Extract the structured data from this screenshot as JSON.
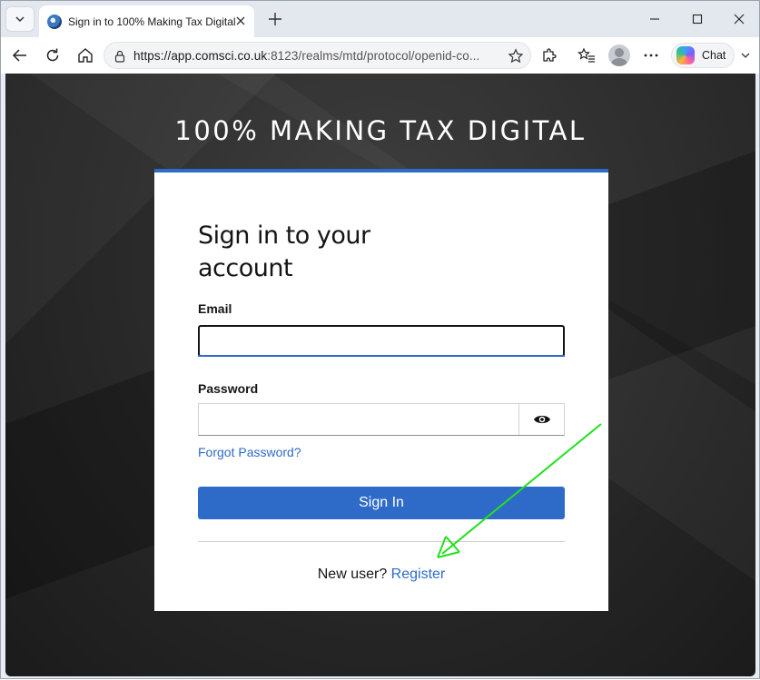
{
  "browser": {
    "tab": {
      "title": "Sign in to 100% Making Tax Digital"
    },
    "address": {
      "url_host": "https://app.comsci.co.uk",
      "url_rest": ":8123/realms/mtd/protocol/openid-co..."
    },
    "chat_label": "Chat",
    "icons": [
      "tab-list-icon",
      "favicon-icon",
      "close-icon",
      "plus-icon",
      "minimize-icon",
      "maximize-icon",
      "close-window-icon",
      "back-icon",
      "refresh-icon",
      "home-icon",
      "lock-icon",
      "star-icon",
      "extensions-icon",
      "favorites-icon",
      "avatar",
      "more-icon",
      "copilot-icon",
      "chevron-down-icon"
    ]
  },
  "page": {
    "brand": "100% MAKING TAX DIGITAL",
    "login": {
      "title": "Sign in to your account",
      "email_label": "Email",
      "email_value": "",
      "password_label": "Password",
      "password_value": "",
      "forgot_label": "Forgot Password?",
      "signin_label": "Sign In",
      "new_user_text": "New user?",
      "register_label": "Register"
    },
    "colors": {
      "accent": "#2e6bc9",
      "annotation": "#22e01c",
      "background": "#262626"
    }
  }
}
